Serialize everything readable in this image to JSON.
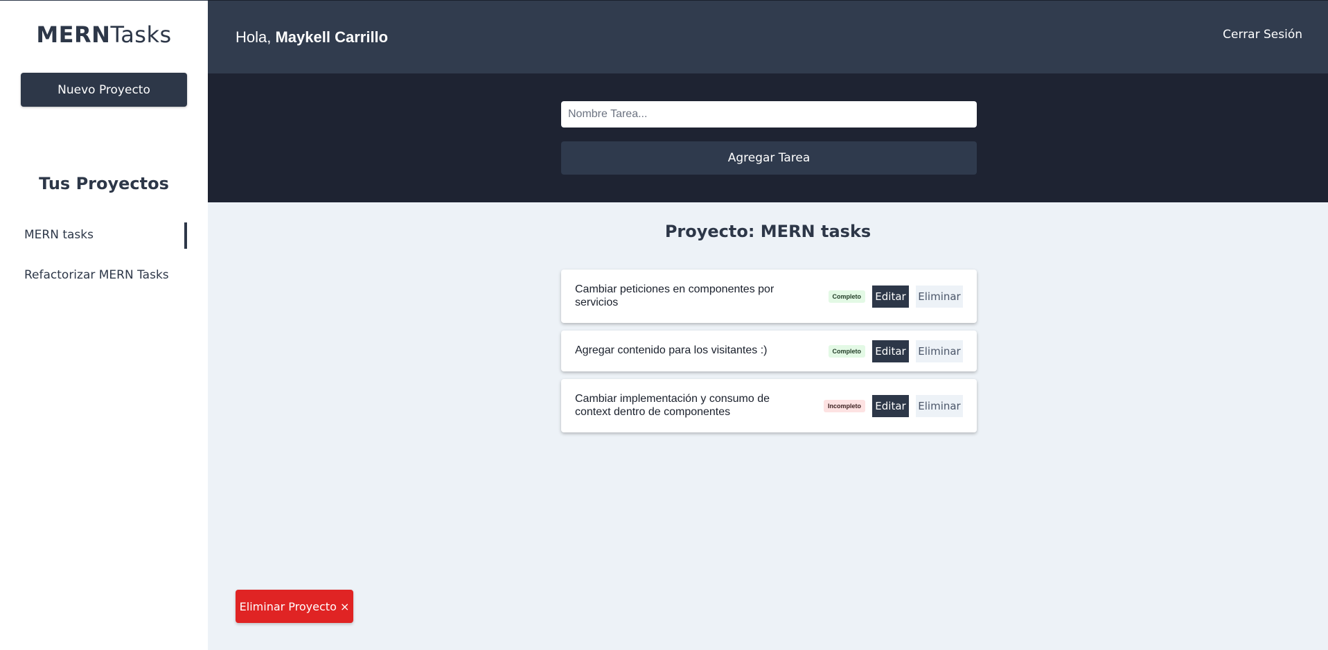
{
  "sidebar": {
    "logo_bold": "MERN",
    "logo_light": "Tasks",
    "new_project_label": "Nuevo Proyecto",
    "heading": "Tus Proyectos",
    "projects": [
      {
        "label": "MERN tasks",
        "active": true
      },
      {
        "label": "Refactorizar MERN Tasks",
        "active": false
      }
    ]
  },
  "header": {
    "greeting_prefix": "Hola,",
    "user_name": "Maykell Carrillo",
    "logout_label": "Cerrar Sesión"
  },
  "task_form": {
    "input_placeholder": "Nombre Tarea...",
    "input_value": "",
    "submit_label": "Agregar Tarea"
  },
  "main": {
    "project_title": "Proyecto: MERN tasks",
    "tasks": [
      {
        "name": "Cambiar peticiones en componentes por servicios",
        "status": "Completo",
        "edit_label": "Editar",
        "delete_label": "Eliminar"
      },
      {
        "name": "Agregar contenido para los visitantes :)",
        "status": "Completo",
        "edit_label": "Editar",
        "delete_label": "Eliminar"
      },
      {
        "name": "Cambiar implementación y consumo de context dentro de componentes",
        "status": "Incompleto",
        "edit_label": "Editar",
        "delete_label": "Eliminar"
      }
    ],
    "delete_project_label": "Eliminar Proyecto ×"
  },
  "colors": {
    "primary": "#2d3748",
    "header_bg": "#313c4e",
    "form_bg": "#1e2332",
    "danger": "#e02424",
    "content_bg": "#edf2f7"
  }
}
